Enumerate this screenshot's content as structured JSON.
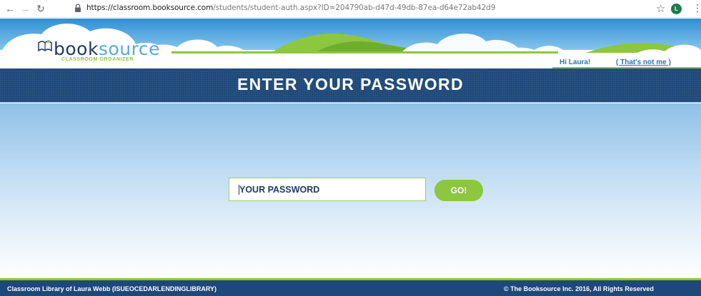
{
  "browser": {
    "url_domain": "https://classroom.booksource.com",
    "url_path": "/students/student-auth.aspx?ID=204790ab-d47d-49db-87ea-d64e72ab42d9",
    "profile_initial": "L"
  },
  "header": {
    "logo_book": "book",
    "logo_source": "source",
    "logo_subtitle": "CLASSROOM ORGANIZER",
    "greeting": "Hi Laura!",
    "not_me_link": "( That's not me )"
  },
  "title": "ENTER YOUR PASSWORD",
  "form": {
    "password_placeholder": "YOUR PASSWORD",
    "go_label": "GO!"
  },
  "footer": {
    "library": "Classroom Library of Laura Webb (ISUEOCEDARLENDINGLIBRARY)",
    "copyright": "© The Booksource Inc. 2016, All Rights Reserved"
  },
  "colors": {
    "navy": "#1d4878",
    "green": "#8dc63f",
    "link_blue": "#2b73b6"
  }
}
